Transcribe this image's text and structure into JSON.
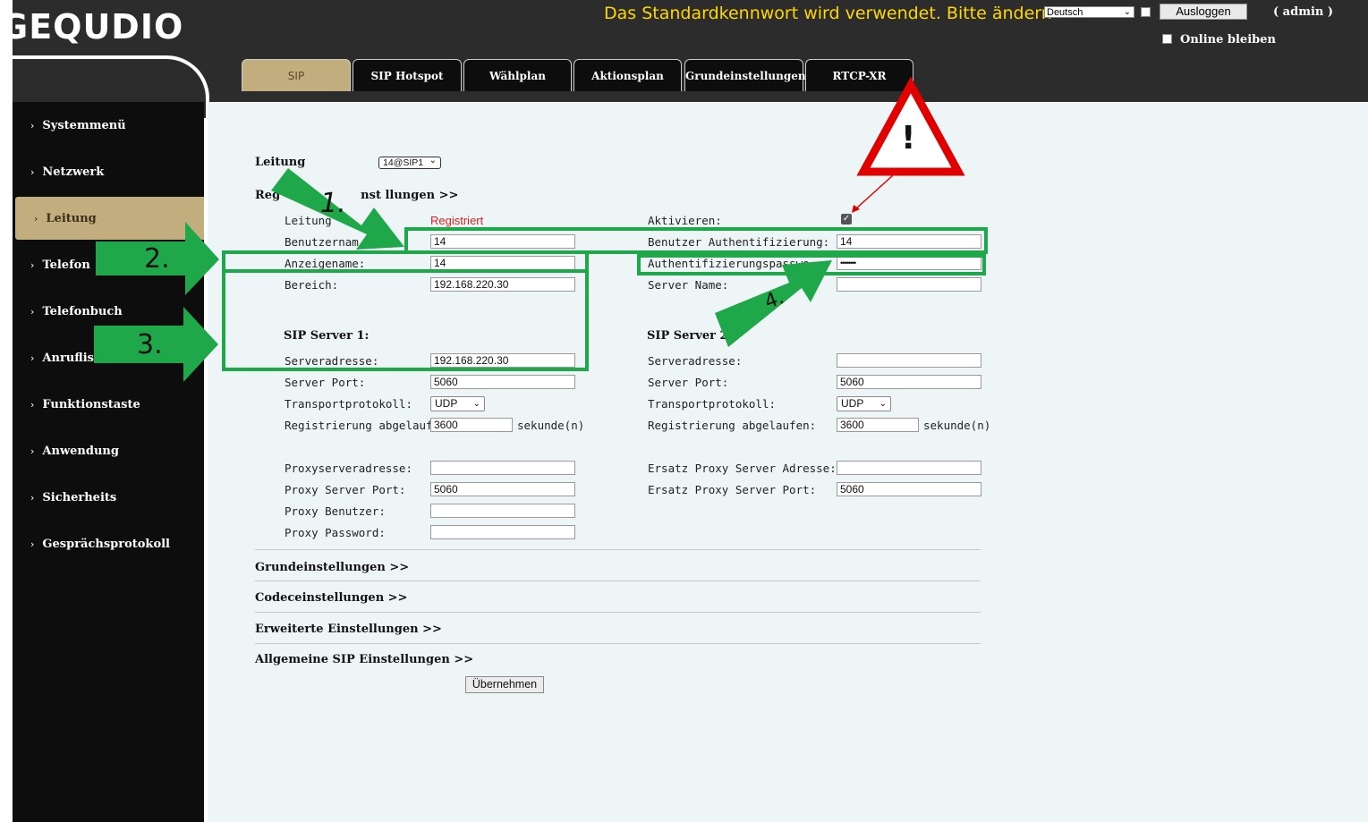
{
  "header": {
    "logo": "GEQUDIO",
    "warning": "Das Standardkennwort wird verwendet. Bitte ändern",
    "language": "Deutsch",
    "logout_label": "Ausloggen",
    "user": "( admin )",
    "stay_online_label": "Online bleiben"
  },
  "sidebar": {
    "items": [
      {
        "label": "Systemmenü"
      },
      {
        "label": "Netzwerk"
      },
      {
        "label": "Leitung"
      },
      {
        "label": "Telefon"
      },
      {
        "label": "Telefonbuch"
      },
      {
        "label": "Anruflis"
      },
      {
        "label": "Funktionstaste"
      },
      {
        "label": "Anwendung"
      },
      {
        "label": "Sicherheits"
      },
      {
        "label": "Gesprächsprotokoll"
      }
    ],
    "active_index": 2
  },
  "tabs": [
    {
      "label": "SIP"
    },
    {
      "label": "SIP Hotspot"
    },
    {
      "label": "Wählplan"
    },
    {
      "label": "Aktionsplan"
    },
    {
      "label": "Grundeinstellungen"
    },
    {
      "label": "RTCP-XR"
    }
  ],
  "form": {
    "line_label": "Leitung",
    "line_value": "14@SIP1",
    "registration_header": "Registereinstellungen >>",
    "registration_header_visible": "Reg",
    "registration_header_tail": "nst llungen >>",
    "line_status_label": "Leitung",
    "line_status_value": "Registriert",
    "username_label": "Benutzernam",
    "username_value": "14",
    "display_name_label": "Anzeigename:",
    "display_name_value": "14",
    "realm_label": "Bereich:",
    "realm_value": "192.168.220.30",
    "activate_label": "Aktivieren:",
    "auth_user_label": "Benutzer Authentifizierung:",
    "auth_user_value": "14",
    "auth_password_label": "Authentifizierungspasswo",
    "auth_password_value": "••••••••",
    "server_name_label": "Server Name:",
    "server_name_value": "",
    "sip_server1": {
      "title": "SIP Server 1:",
      "address_label": "Serveradresse:",
      "address_value": "192.168.220.30",
      "port_label": "Server Port:",
      "port_value": "5060",
      "transport_label": "Transportprotokoll:",
      "transport_value": "UDP",
      "expiry_label": "Registrierung abgelaufen:",
      "expiry_value": "3600",
      "expiry_unit": "sekunde(n)"
    },
    "sip_server2": {
      "title": "SIP Server 2:",
      "address_label": "Serveradresse:",
      "address_value": "",
      "port_label": "Server Port:",
      "port_value": "5060",
      "transport_label": "Transportprotokoll:",
      "transport_value": "UDP",
      "expiry_label": "Registrierung abgelaufen:",
      "expiry_value": "3600",
      "expiry_unit": "sekunde(n)"
    },
    "proxy": {
      "address_label": "Proxyserveradresse:",
      "address_value": "",
      "port_label": "Proxy Server Port:",
      "port_value": "5060",
      "user_label": "Proxy Benutzer:",
      "user_value": "",
      "password_label": "Proxy Password:",
      "password_value": "",
      "backup_address_label": "Ersatz Proxy Server Adresse:",
      "backup_address_value": "",
      "backup_port_label": "Ersatz Proxy Server Port:",
      "backup_port_value": "5060"
    },
    "sections": [
      {
        "label": "Grundeinstellungen >>"
      },
      {
        "label": "Codeceinstellungen >>"
      },
      {
        "label": "Erweiterte Einstellungen >>"
      },
      {
        "label": "Allgemeine SIP Einstellungen >>"
      }
    ],
    "apply_label": "Übernehmen"
  },
  "annotations": {
    "step1": "1.",
    "step2": "2.",
    "step3": "3.",
    "step4": "4.",
    "warning_mark": "!",
    "arrow_color": "#1fa84a",
    "warning_color": "#e00000"
  }
}
